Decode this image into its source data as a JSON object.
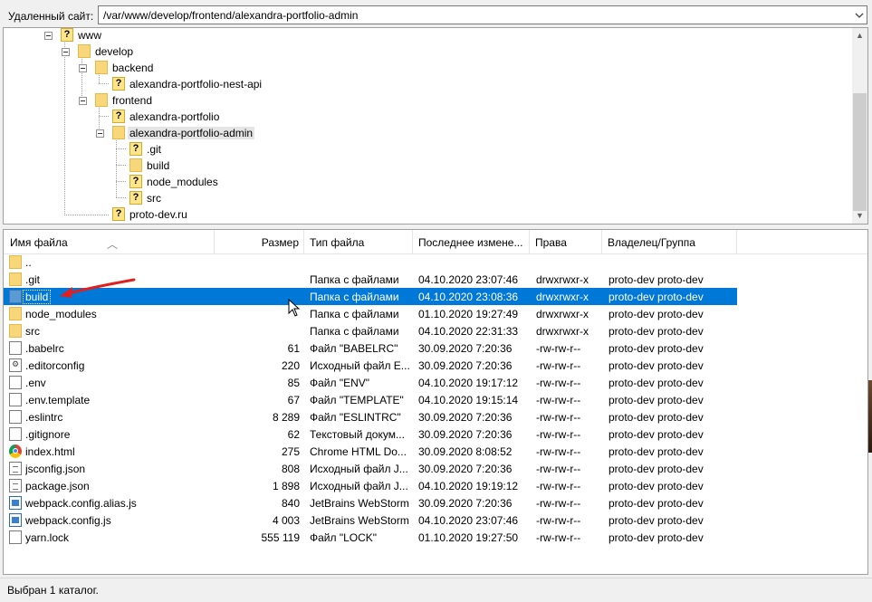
{
  "address_bar": {
    "label": "Удаленный сайт:",
    "path": "/var/www/develop/frontend/alexandra-portfolio-admin"
  },
  "tree": {
    "nodes": [
      {
        "label": "www",
        "icon": "question-folder-icon"
      },
      {
        "label": "develop",
        "icon": "folder-icon"
      },
      {
        "label": "backend",
        "icon": "folder-icon"
      },
      {
        "label": "alexandra-portfolio-nest-api",
        "icon": "question-folder-icon"
      },
      {
        "label": "frontend",
        "icon": "folder-icon"
      },
      {
        "label": "alexandra-portfolio",
        "icon": "question-folder-icon"
      },
      {
        "label": "alexandra-portfolio-admin",
        "icon": "folder-icon"
      },
      {
        "label": ".git",
        "icon": "question-folder-icon"
      },
      {
        "label": "build",
        "icon": "folder-icon"
      },
      {
        "label": "node_modules",
        "icon": "question-folder-icon"
      },
      {
        "label": "src",
        "icon": "question-folder-icon"
      },
      {
        "label": "proto-dev.ru",
        "icon": "question-folder-icon"
      }
    ]
  },
  "file_list": {
    "columns": [
      "Имя файла",
      "Размер",
      "Тип файла",
      "Последнее измене...",
      "Права",
      "Владелец/Группа"
    ],
    "rows": [
      {
        "name": "..",
        "size": "",
        "type": "",
        "modified": "",
        "perms": "",
        "owner": "",
        "icon": "folder-icon"
      },
      {
        "name": ".git",
        "size": "",
        "type": "Папка с файлами",
        "modified": "04.10.2020 23:07:46",
        "perms": "drwxrwxr-x",
        "owner": "proto-dev proto-dev",
        "icon": "folder-icon"
      },
      {
        "name": "build",
        "size": "",
        "type": "Папка с файлами",
        "modified": "04.10.2020 23:08:36",
        "perms": "drwxrwxr-x",
        "owner": "proto-dev proto-dev",
        "icon": "folder-icon",
        "selected": true
      },
      {
        "name": "node_modules",
        "size": "",
        "type": "Папка с файлами",
        "modified": "01.10.2020 19:27:49",
        "perms": "drwxrwxr-x",
        "owner": "proto-dev proto-dev",
        "icon": "folder-icon"
      },
      {
        "name": "src",
        "size": "",
        "type": "Папка с файлами",
        "modified": "04.10.2020 22:31:33",
        "perms": "drwxrwxr-x",
        "owner": "proto-dev proto-dev",
        "icon": "folder-icon"
      },
      {
        "name": ".babelrc",
        "size": "61",
        "type": "Файл \"BABELRC\"",
        "modified": "30.09.2020 7:20:36",
        "perms": "-rw-rw-r--",
        "owner": "proto-dev proto-dev",
        "icon": "file-icon"
      },
      {
        "name": ".editorconfig",
        "size": "220",
        "type": "Исходный файл E...",
        "modified": "30.09.2020 7:20:36",
        "perms": "-rw-rw-r--",
        "owner": "proto-dev proto-dev",
        "icon": "config-file-icon"
      },
      {
        "name": ".env",
        "size": "85",
        "type": "Файл \"ENV\"",
        "modified": "04.10.2020 19:17:12",
        "perms": "-rw-rw-r--",
        "owner": "proto-dev proto-dev",
        "icon": "file-icon"
      },
      {
        "name": ".env.template",
        "size": "67",
        "type": "Файл \"TEMPLATE\"",
        "modified": "04.10.2020 19:15:14",
        "perms": "-rw-rw-r--",
        "owner": "proto-dev proto-dev",
        "icon": "file-icon"
      },
      {
        "name": ".eslintrc",
        "size": "8 289",
        "type": "Файл \"ESLINTRC\"",
        "modified": "30.09.2020 7:20:36",
        "perms": "-rw-rw-r--",
        "owner": "proto-dev proto-dev",
        "icon": "file-icon"
      },
      {
        "name": ".gitignore",
        "size": "62",
        "type": "Текстовый докум...",
        "modified": "30.09.2020 7:20:36",
        "perms": "-rw-rw-r--",
        "owner": "proto-dev proto-dev",
        "icon": "text-file-icon"
      },
      {
        "name": "index.html",
        "size": "275",
        "type": "Chrome HTML Do...",
        "modified": "30.09.2020 8:08:52",
        "perms": "-rw-rw-r--",
        "owner": "proto-dev proto-dev",
        "icon": "chrome-icon"
      },
      {
        "name": "jsconfig.json",
        "size": "808",
        "type": "Исходный файл J...",
        "modified": "30.09.2020 7:20:36",
        "perms": "-rw-rw-r--",
        "owner": "proto-dev proto-dev",
        "icon": "json-file-icon"
      },
      {
        "name": "package.json",
        "size": "1 898",
        "type": "Исходный файл J...",
        "modified": "04.10.2020 19:19:12",
        "perms": "-rw-rw-r--",
        "owner": "proto-dev proto-dev",
        "icon": "json-file-icon"
      },
      {
        "name": "webpack.config.alias.js",
        "size": "840",
        "type": "JetBrains WebStorm",
        "modified": "30.09.2020 7:20:36",
        "perms": "-rw-rw-r--",
        "owner": "proto-dev proto-dev",
        "icon": "webstorm-icon"
      },
      {
        "name": "webpack.config.js",
        "size": "4 003",
        "type": "JetBrains WebStorm",
        "modified": "04.10.2020 23:07:46",
        "perms": "-rw-rw-r--",
        "owner": "proto-dev proto-dev",
        "icon": "webstorm-icon"
      },
      {
        "name": "yarn.lock",
        "size": "555 119",
        "type": "Файл \"LOCK\"",
        "modified": "01.10.2020 19:27:50",
        "perms": "-rw-rw-r--",
        "owner": "proto-dev proto-dev",
        "icon": "file-icon"
      }
    ]
  },
  "status_bar": {
    "text": "Выбран 1 каталог."
  },
  "colors": {
    "selection": "#0078d7",
    "folder": "#f7d779",
    "annotation_arrow": "#e02020"
  }
}
